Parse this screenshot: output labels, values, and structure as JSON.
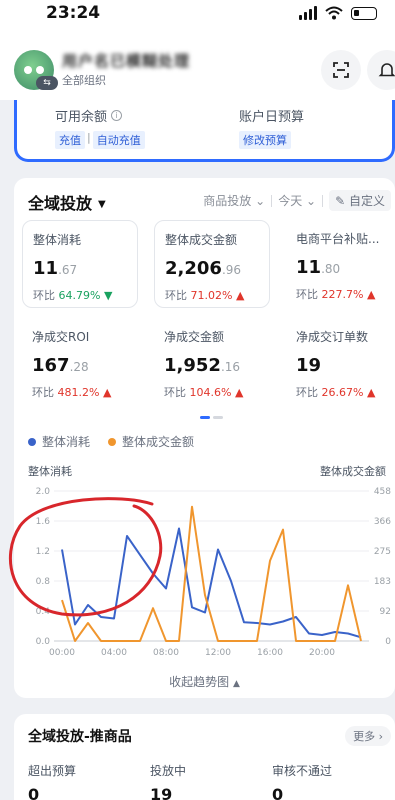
{
  "status_bar": {
    "time": "23:24"
  },
  "header": {
    "account_name": "用户名已模糊处理",
    "org_label": "全部组织",
    "avatar_swap": "⇆"
  },
  "balance": {
    "available_label": "可用余额",
    "recharge_link": "充值",
    "auto_recharge_link": "自动充值",
    "budget_label": "账户日预算",
    "modify_budget_link": "修改预算"
  },
  "panel": {
    "title": "全域投放",
    "filter_product": "商品投放",
    "filter_date": "今天",
    "custom_button": "自定义",
    "collapse_label": "收起趋势图"
  },
  "metrics": [
    {
      "label": "整体消耗",
      "int": "11",
      "dec": ".67",
      "change_label": "环比",
      "change": "64.79%",
      "arrow": "▼",
      "dir": "down"
    },
    {
      "label": "整体成交金额",
      "int": "2,206",
      "dec": ".96",
      "change_label": "环比",
      "change": "71.02%",
      "arrow": "▲",
      "dir": "up"
    },
    {
      "label": "电商平台补贴...",
      "int": "11",
      "dec": ".80",
      "change_label": "环比",
      "change": "227.7%",
      "arrow": "▲",
      "dir": "up"
    },
    {
      "label": "净成交ROI",
      "int": "167",
      "dec": ".28",
      "change_label": "环比",
      "change": "481.2%",
      "arrow": "▲",
      "dir": "up"
    },
    {
      "label": "净成交金额",
      "int": "1,952",
      "dec": ".16",
      "change_label": "环比",
      "change": "104.6%",
      "arrow": "▲",
      "dir": "up"
    },
    {
      "label": "净成交订单数",
      "int": "19",
      "dec": "",
      "change_label": "环比",
      "change": "26.67%",
      "arrow": "▲",
      "dir": "up"
    }
  ],
  "colors": {
    "series_blue": "#3a63c9",
    "series_orange": "#f0962e",
    "up": "#e0352b",
    "down": "#1aa260",
    "annotation": "#d8262b"
  },
  "chart_data": {
    "type": "line",
    "left_axis_label": "整体消耗",
    "right_axis_label": "整体成交金额",
    "x_ticks": [
      "00:00",
      "04:00",
      "08:00",
      "12:00",
      "16:00",
      "20:00"
    ],
    "left_ticks": [
      "0.0",
      "0.4",
      "0.8",
      "1.2",
      "1.6",
      "2.0"
    ],
    "right_ticks": [
      "0",
      "92",
      "183",
      "275",
      "366",
      "458"
    ],
    "ylim_left": [
      0,
      2.0
    ],
    "ylim_right": [
      0,
      458
    ],
    "x_hours": [
      0,
      1,
      2,
      3,
      4,
      5,
      6,
      7,
      8,
      9,
      10,
      11,
      12,
      13,
      14,
      15,
      16,
      17,
      18,
      19,
      20,
      21,
      22,
      23
    ],
    "series": [
      {
        "name": "整体消耗",
        "axis": "left",
        "values": [
          1.22,
          0.22,
          0.48,
          0.32,
          0.3,
          1.4,
          1.15,
          0.9,
          0.7,
          1.5,
          0.45,
          0.38,
          1.22,
          0.8,
          0.25,
          0.24,
          0.22,
          0.26,
          0.32,
          0.1,
          0.08,
          0.12,
          0.1,
          0.05
        ]
      },
      {
        "name": "整体成交金额",
        "axis": "right",
        "values": [
          125,
          0,
          55,
          0,
          0,
          0,
          0,
          100,
          0,
          0,
          410,
          140,
          0,
          0,
          0,
          0,
          245,
          340,
          0,
          0,
          0,
          0,
          170,
          0
        ]
      }
    ],
    "grid": true,
    "legend": "top-left"
  },
  "bottom_card": {
    "title": "全域投放-推商品",
    "more": "更多 ›",
    "stats": [
      {
        "label": "超出预算",
        "value": "0"
      },
      {
        "label": "投放中",
        "value": "19"
      },
      {
        "label": "审核不通过",
        "value": "0"
      }
    ]
  }
}
